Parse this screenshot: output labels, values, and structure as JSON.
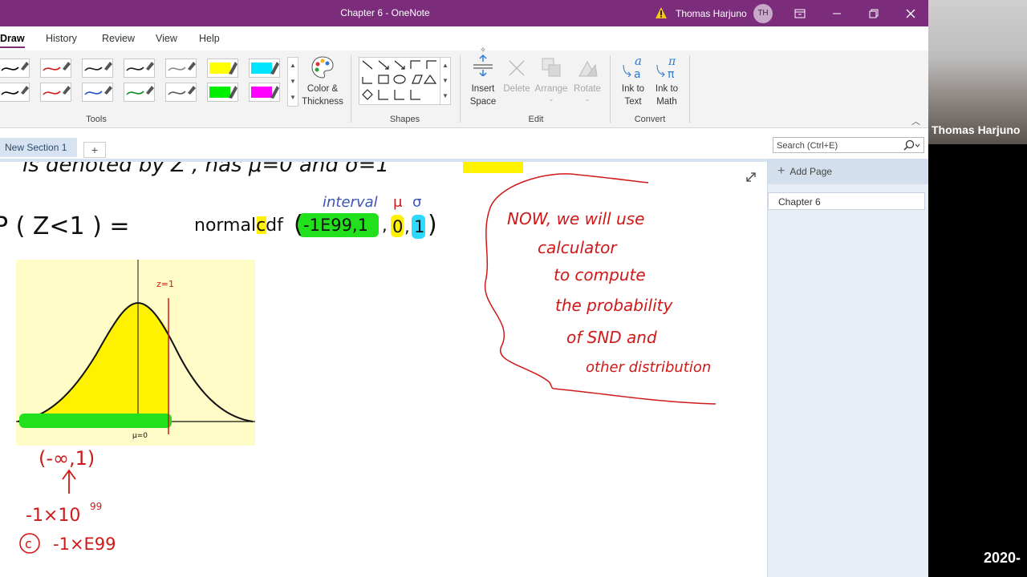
{
  "window": {
    "title": "Chapter 6  -  OneNote",
    "user_name": "Thomas Harjuno",
    "user_initials": "TH"
  },
  "ribbon_tabs": [
    "Draw",
    "History",
    "Review",
    "View",
    "Help"
  ],
  "ribbon": {
    "tools_label": "Tools",
    "shapes_label": "Shapes",
    "edit_label": "Edit",
    "convert_label": "Convert",
    "color_thickness": [
      "Color &",
      "Thickness"
    ],
    "insert_space": [
      "Insert",
      "Space"
    ],
    "delete": "Delete",
    "arrange": "Arrange",
    "rotate": "Rotate",
    "ink_to_text": [
      "Ink to",
      "Text"
    ],
    "ink_to_math": [
      "Ink to",
      "Math"
    ],
    "pen_colors_row1": [
      "#000000",
      "#d01818",
      "#1a1a1a",
      "#1a1a1a",
      "#888888",
      "#ffff00",
      "#00e5ff"
    ],
    "pen_colors_row2": [
      "#000000",
      "#d01818",
      "#2050c0",
      "#118822",
      "#555555",
      "#00ee00",
      "#ff00ff"
    ]
  },
  "section": {
    "tab_label": "New Section 1",
    "add_label": "+",
    "search_placeholder": "Search (Ctrl+E)"
  },
  "page_pane": {
    "add_page": "Add Page",
    "pages": [
      "Chapter 6"
    ]
  },
  "canvas": {
    "top_line": "is denoted by Z , has  μ=0  and  σ=1",
    "formula_left": "P ( Z<1 )  =",
    "formula_func": "normalcdf",
    "formula_args": [
      "-1E99,1",
      "0",
      "1"
    ],
    "annot_interval": "interval",
    "annot_mu": "μ",
    "annot_sigma": "σ",
    "graph_z_label": "z=1",
    "graph_mu_label": "μ=0",
    "interval_text": "(-∞,1)",
    "minus_exp": "-1×10",
    "minus_exp_power": "99",
    "c_marker": "c",
    "minus_E": "-1×E99",
    "note_lines": [
      "NOW, we will use",
      "calculator",
      "to compute",
      "the probability",
      "of SND and",
      "other distribution"
    ]
  },
  "webcam": {
    "name": "Thomas Harjuno",
    "date_fragment": "2020-"
  },
  "colors": {
    "title_bar": "#7b2d7c",
    "ink_black": "#111111",
    "ink_red": "#d01818",
    "ink_blue": "#3a55b4",
    "highlight_green": "#22e01c",
    "highlight_yellow": "#fff200",
    "highlight_cyan": "#2fd8ff",
    "graph_bg": "#fffcc8"
  }
}
